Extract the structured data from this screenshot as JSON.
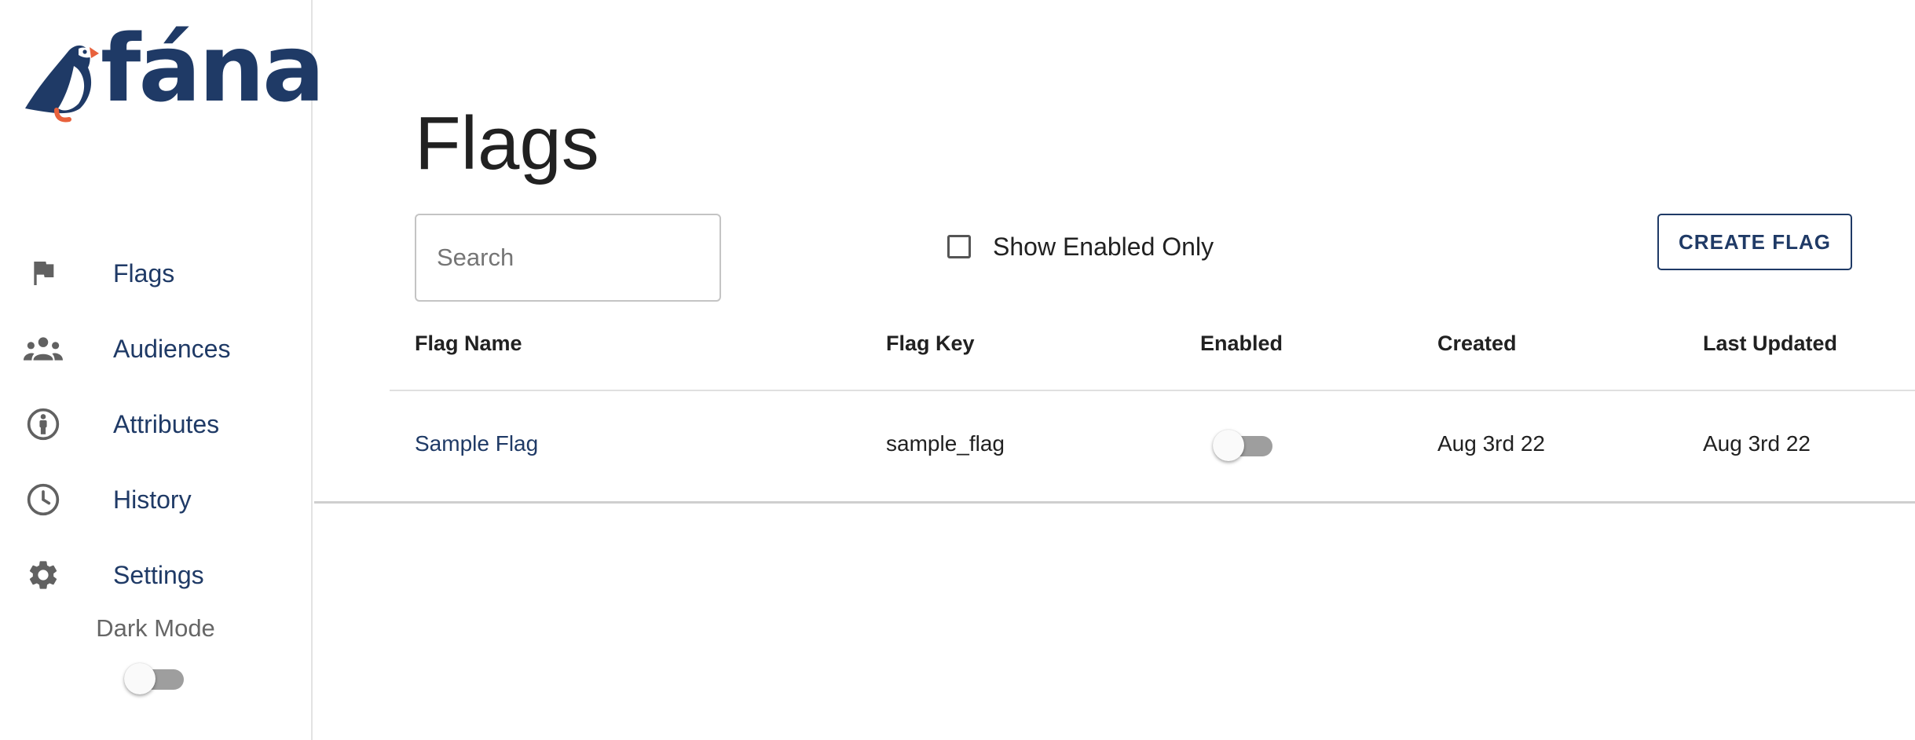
{
  "app": {
    "logo_text": "fána"
  },
  "sidebar": {
    "items": [
      {
        "label": "Flags",
        "icon": "flag-icon"
      },
      {
        "label": "Audiences",
        "icon": "people-icon"
      },
      {
        "label": "Attributes",
        "icon": "info-person-icon"
      },
      {
        "label": "History",
        "icon": "clock-icon"
      },
      {
        "label": "Settings",
        "icon": "gear-icon"
      }
    ],
    "dark_mode_label": "Dark Mode",
    "dark_mode_on": false
  },
  "main": {
    "title": "Flags",
    "search": {
      "placeholder": "Search",
      "value": ""
    },
    "show_enabled_only": {
      "label": "Show Enabled Only",
      "checked": false
    },
    "create_button_label": "CREATE FLAG",
    "table": {
      "columns": [
        "Flag Name",
        "Flag Key",
        "Enabled",
        "Created",
        "Last Updated"
      ],
      "rows": [
        {
          "name": "Sample Flag",
          "key": "sample_flag",
          "enabled": false,
          "created": "Aug 3rd 22",
          "updated": "Aug 3rd 22"
        }
      ]
    }
  },
  "colors": {
    "brand": "#1f3a66",
    "puffin_beak": "#e8613c",
    "icon_grey": "#616161",
    "switch_track_off": "#9e9e9e"
  }
}
